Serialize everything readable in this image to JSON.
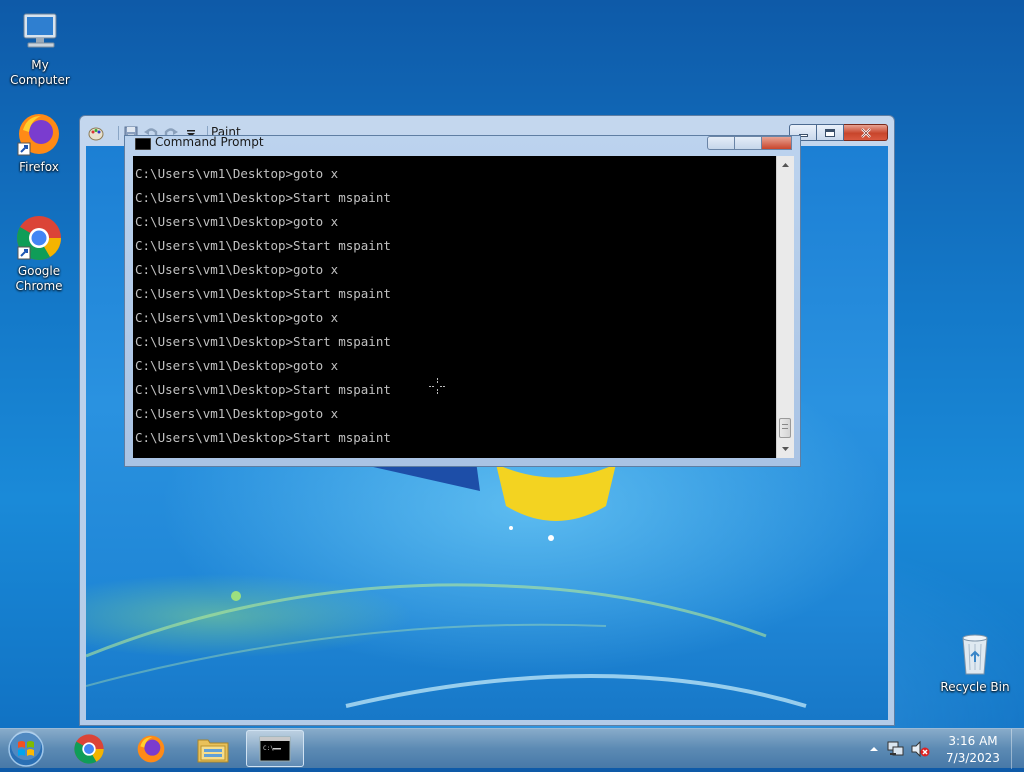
{
  "desktop": {
    "icons": [
      {
        "label": "My Computer",
        "icon": "computer-icon"
      },
      {
        "label": "Firefox",
        "icon": "firefox-icon"
      },
      {
        "label": "Google Chrome",
        "icon": "chrome-icon"
      },
      {
        "label": "Recycle Bin",
        "icon": "recycle-bin-icon"
      }
    ]
  },
  "paint_window": {
    "title": "Paint"
  },
  "cmd_window": {
    "title": "Command Prompt",
    "lines": [
      "C:\\Users\\vm1\\Desktop>goto x",
      "C:\\Users\\vm1\\Desktop>Start mspaint",
      "C:\\Users\\vm1\\Desktop>goto x",
      "C:\\Users\\vm1\\Desktop>Start mspaint",
      "C:\\Users\\vm1\\Desktop>goto x",
      "C:\\Users\\vm1\\Desktop>Start mspaint",
      "C:\\Users\\vm1\\Desktop>goto x",
      "C:\\Users\\vm1\\Desktop>Start mspaint",
      "C:\\Users\\vm1\\Desktop>goto x",
      "C:\\Users\\vm1\\Desktop>Start mspaint",
      "C:\\Users\\vm1\\Desktop>goto x",
      "C:\\Users\\vm1\\Desktop>Start mspaint"
    ]
  },
  "taskbar": {
    "items": [
      "start-orb",
      "chrome-icon",
      "firefox-icon",
      "file-explorer-icon",
      "command-prompt-icon"
    ],
    "clock": {
      "time": "3:16 AM",
      "date": "7/3/2023"
    }
  }
}
